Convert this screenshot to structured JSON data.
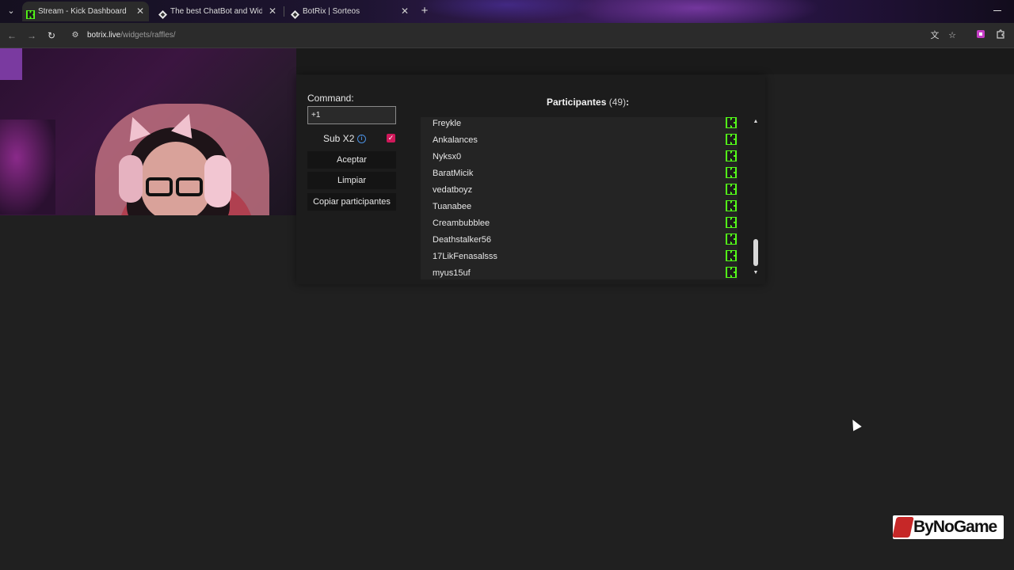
{
  "browser": {
    "tabs": [
      {
        "title": "Stream - Kick Dashboard",
        "icon": "kick-icon",
        "active": true
      },
      {
        "title": "The best ChatBot and Widgets",
        "icon": "botrix-icon",
        "active": false
      },
      {
        "title": "BotRix | Sorteos",
        "icon": "botrix-icon",
        "active": false
      }
    ],
    "url": {
      "host": "botrix.live",
      "path": "/widgets/raffles/"
    }
  },
  "widget": {
    "command_label": "Command:",
    "command_value": "+1",
    "sub_label": "Sub X2",
    "sub_checked": true,
    "accept_label": "Aceptar",
    "clear_label": "Limpiar",
    "copy_label": "Copiar participantes",
    "participants_title": "Participantes",
    "participants_count": "(49)",
    "participants_colon": ":",
    "participants": [
      {
        "name": "Freykle",
        "platform": "kick-icon"
      },
      {
        "name": "Ankalances",
        "platform": "kick-icon"
      },
      {
        "name": "Nyksx0",
        "platform": "kick-icon"
      },
      {
        "name": "BaratMicik",
        "platform": "kick-icon"
      },
      {
        "name": "vedatboyz",
        "platform": "kick-icon"
      },
      {
        "name": "Tuanabee",
        "platform": "kick-icon"
      },
      {
        "name": "Creambubblee",
        "platform": "kick-icon"
      },
      {
        "name": "Deathstalker56",
        "platform": "kick-icon"
      },
      {
        "name": "17LikFenasalsss",
        "platform": "kick-icon"
      },
      {
        "name": "myus15uf",
        "platform": "kick-icon"
      }
    ]
  },
  "watermark": {
    "text": "ByNoGame"
  },
  "colors": {
    "kick_green": "#53fc18",
    "checkbox": "#d0185a",
    "info": "#4a8fe0"
  }
}
